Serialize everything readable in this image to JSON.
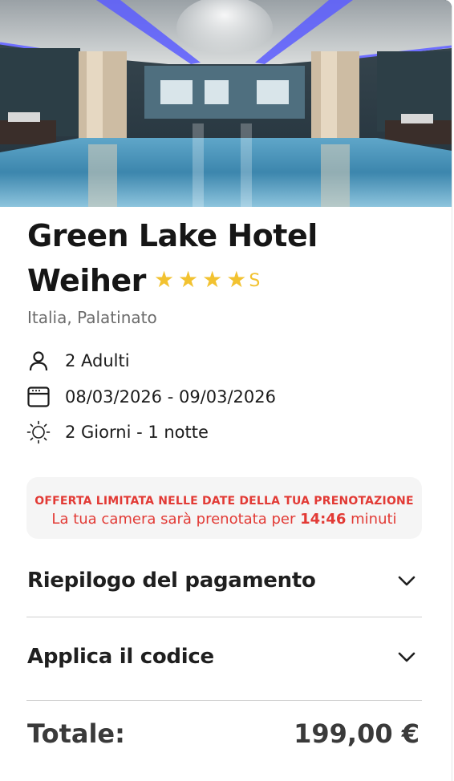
{
  "hotel": {
    "name_line1": "Green Lake Hotel",
    "name_line2": "Weiher",
    "stars": "★★★★",
    "stars_suffix": "S",
    "rating_stars": 4,
    "location": "Italia, Palatinato"
  },
  "booking": {
    "guests": "2 Adulti",
    "dates": "08/03/2026 - 09/03/2026",
    "duration": "2 Giorni - 1 notte"
  },
  "offer": {
    "title": "OFFERTA LIMITATA NELLE DATE DELLA TUA PRENOTAZIONE",
    "text_before": "La tua camera sarà prenotata per ",
    "countdown": "14:46",
    "text_after": " minuti"
  },
  "accordion": {
    "payment_summary": "Riepilogo del pagamento",
    "apply_code": "Applica il codice"
  },
  "total": {
    "label": "Totale:",
    "value": "199,00 €"
  },
  "icons": {
    "guests": "user-icon",
    "dates": "calendar-icon",
    "duration": "sun-icon",
    "expand": "chevron-down-icon"
  },
  "colors": {
    "star": "#f2c230",
    "offer_text": "#e23a35",
    "offer_bg": "#f5f5f5"
  }
}
